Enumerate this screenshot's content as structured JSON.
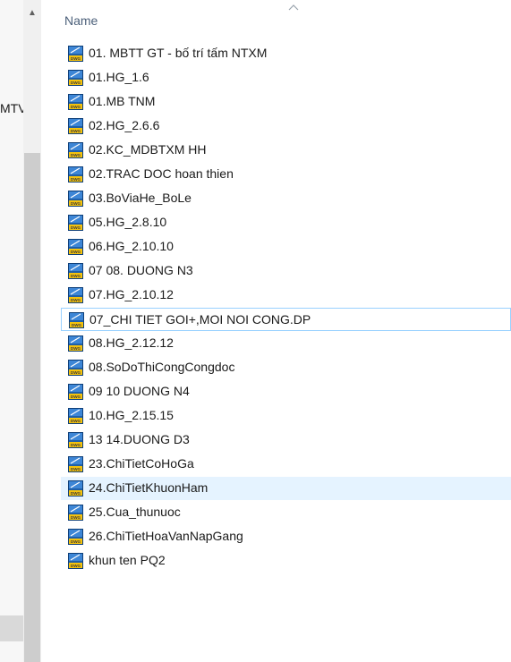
{
  "navigation": {
    "visible_fragment": "MTV"
  },
  "file_list": {
    "column_header": "Name",
    "sort": "ascending",
    "file_icon": "dwg-file-icon",
    "files": [
      {
        "name": "01. MBTT GT - bố trí tấm NTXM",
        "state": ""
      },
      {
        "name": "01.HG_1.6",
        "state": ""
      },
      {
        "name": "01.MB TNM",
        "state": ""
      },
      {
        "name": "02.HG_2.6.6",
        "state": ""
      },
      {
        "name": "02.KC_MDBTXM HH",
        "state": ""
      },
      {
        "name": "02.TRAC DOC hoan thien",
        "state": ""
      },
      {
        "name": "03.BoViaHe_BoLe",
        "state": ""
      },
      {
        "name": "05.HG_2.8.10",
        "state": ""
      },
      {
        "name": "06.HG_2.10.10",
        "state": ""
      },
      {
        "name": "07 08. DUONG N3",
        "state": ""
      },
      {
        "name": "07.HG_2.10.12",
        "state": ""
      },
      {
        "name": "07_CHI TIET GOI+,MOI NOI CONG.DP",
        "state": "focused"
      },
      {
        "name": "08.HG_2.12.12",
        "state": ""
      },
      {
        "name": "08.SoDoThiCongCongdoc",
        "state": ""
      },
      {
        "name": "09 10 DUONG N4",
        "state": ""
      },
      {
        "name": "10.HG_2.15.15",
        "state": ""
      },
      {
        "name": "13 14.DUONG D3",
        "state": ""
      },
      {
        "name": "23.ChiTietCoHoGa",
        "state": ""
      },
      {
        "name": "24.ChiTietKhuonHam",
        "state": "hovered"
      },
      {
        "name": "25.Cua_thunuoc",
        "state": ""
      },
      {
        "name": "26.ChiTietHoaVanNapGang",
        "state": ""
      },
      {
        "name": "khun ten PQ2",
        "state": ""
      }
    ]
  },
  "colors": {
    "header_text": "#4c607a",
    "hover_bg": "#e5f3ff",
    "focus_border": "#99d1ff",
    "icon_blue": "#1f5fa8",
    "icon_yellow": "#f4c20d"
  }
}
